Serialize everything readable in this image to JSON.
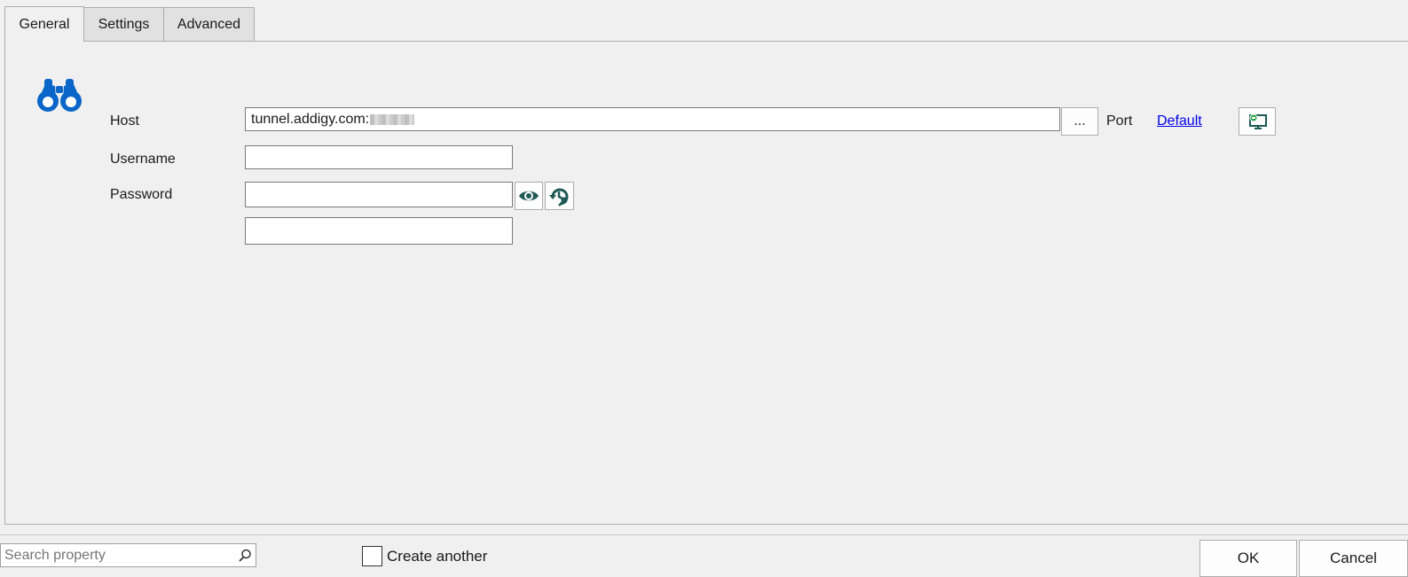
{
  "tabs": [
    {
      "label": "General",
      "active": true
    },
    {
      "label": "Settings",
      "active": false
    },
    {
      "label": "Advanced",
      "active": false
    }
  ],
  "form": {
    "host_label": "Host",
    "host_value": "tunnel.addigy.com:",
    "browse_label": "...",
    "port_label": "Port",
    "port_link": "Default",
    "username_label": "Username",
    "username_value": "",
    "password_label": "Password",
    "password_value": "",
    "extra_value": ""
  },
  "footer": {
    "search_placeholder": "Search property",
    "create_another_label": "Create another",
    "create_another_checked": false,
    "ok_label": "OK",
    "cancel_label": "Cancel"
  },
  "icons": {
    "header_icon": "binoculars-icon",
    "show_password": "eye-icon",
    "password_history": "history-key-icon",
    "monitor": "monitor-connect-icon",
    "search": "magnifier-icon"
  },
  "colors": {
    "accent_blue": "#0a66c8",
    "icon_teal": "#1e5a55",
    "link_blue": "#0000ee",
    "monitor_green": "#2ea44f"
  }
}
